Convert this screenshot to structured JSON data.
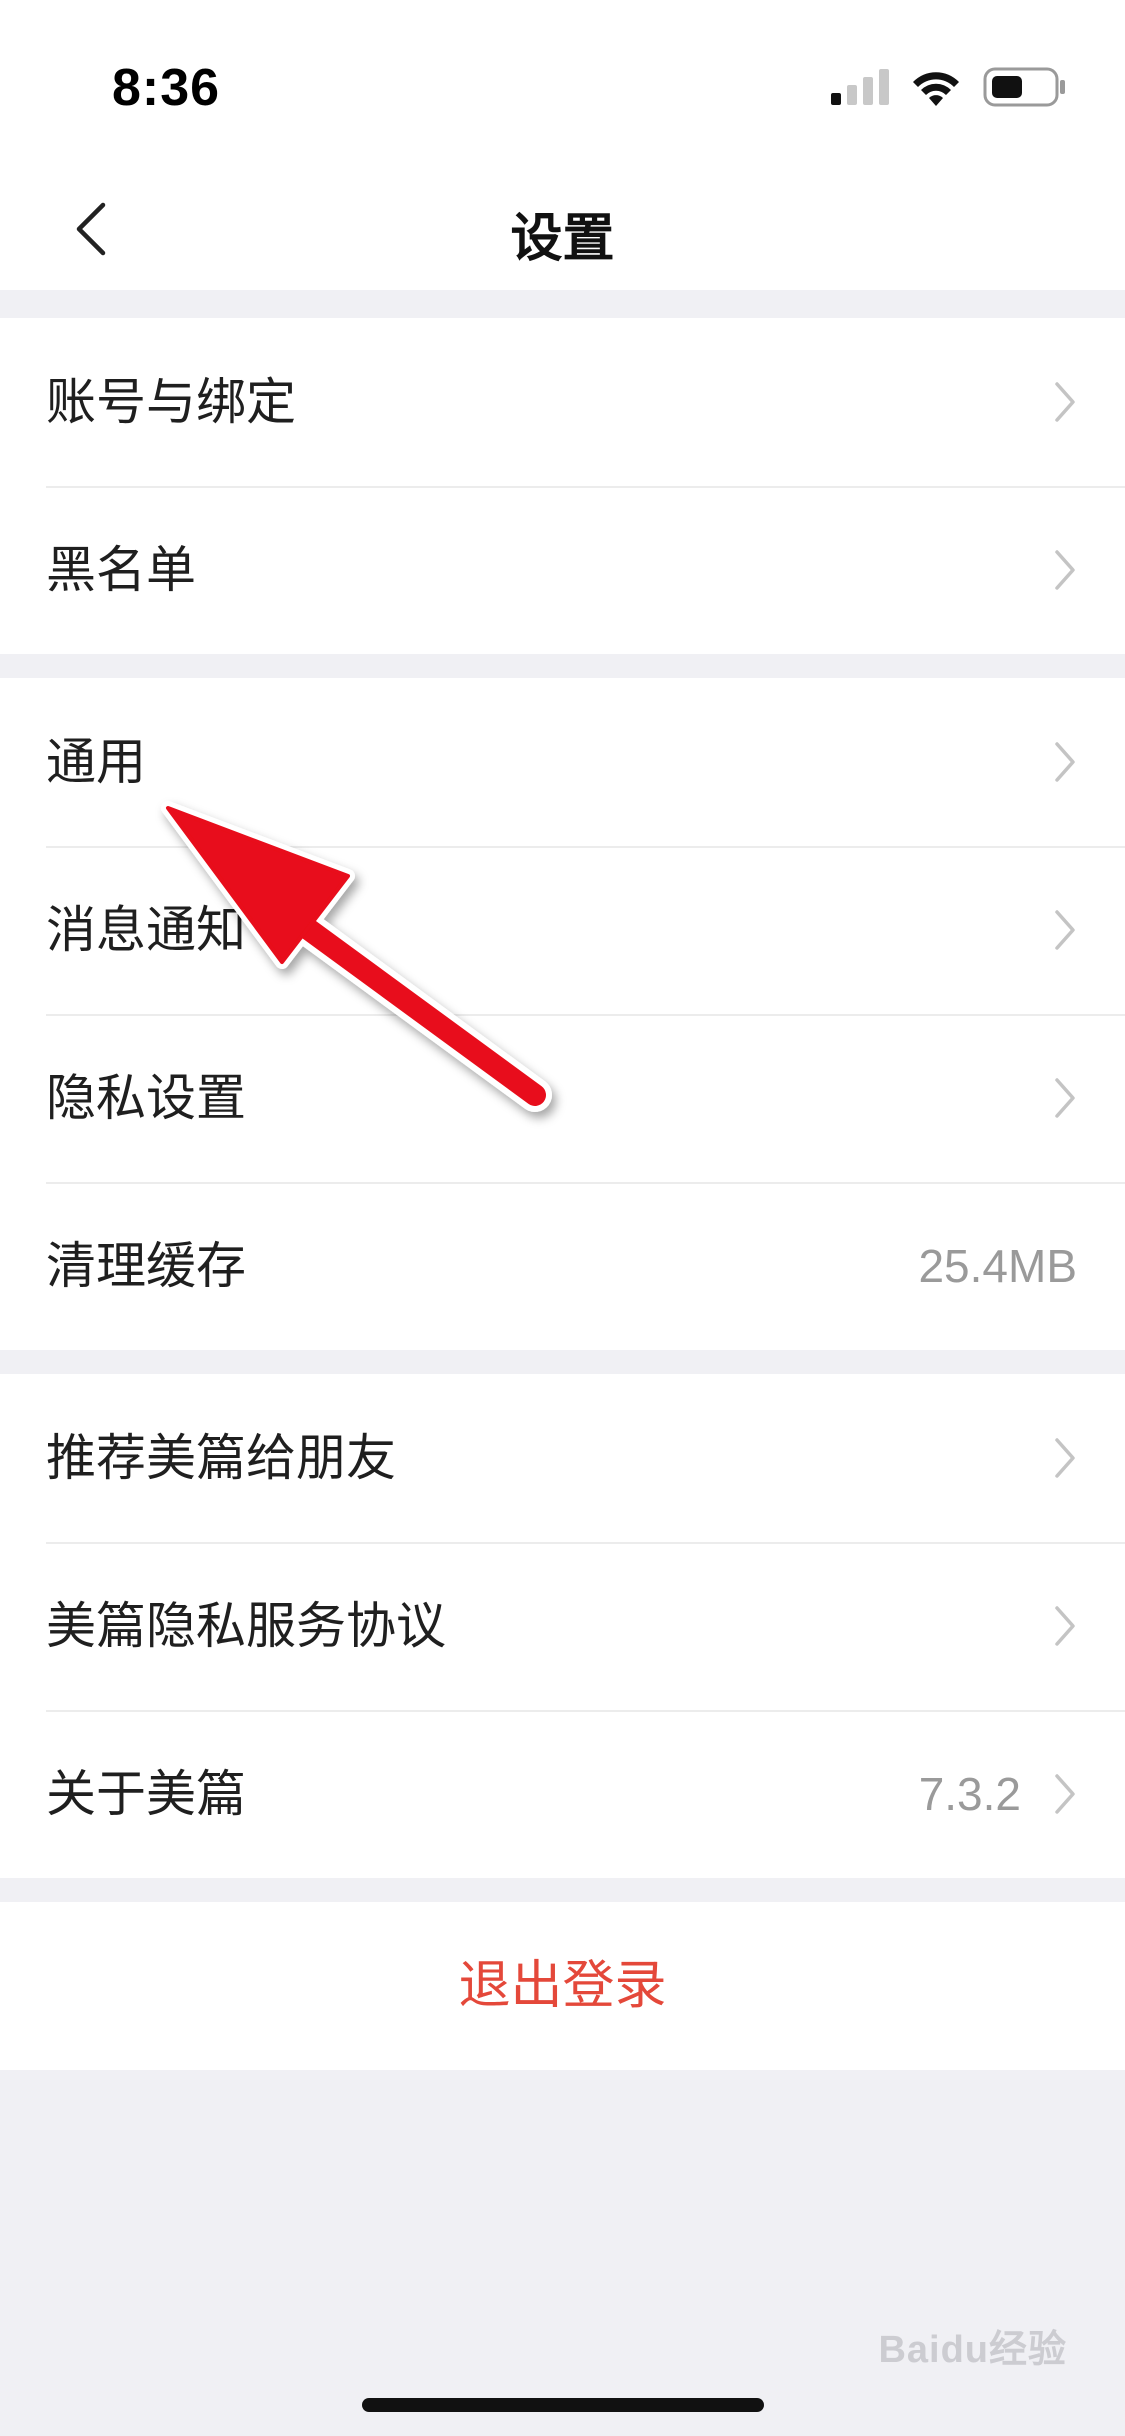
{
  "status_bar": {
    "time": "8:36"
  },
  "nav": {
    "title": "设置"
  },
  "groups": [
    {
      "rows": [
        {
          "label": "账号与绑定"
        },
        {
          "label": "黑名单"
        }
      ]
    },
    {
      "rows": [
        {
          "label": "通用"
        },
        {
          "label": "消息通知"
        },
        {
          "label": "隐私设置"
        },
        {
          "label": "清理缓存",
          "value": "25.4MB"
        }
      ]
    },
    {
      "rows": [
        {
          "label": "推荐美篇给朋友"
        },
        {
          "label": "美篇隐私服务协议"
        },
        {
          "label": "关于美篇",
          "value": "7.3.2"
        }
      ]
    }
  ],
  "logout": {
    "label": "退出登录"
  },
  "watermark": {
    "text": "Baidu经验"
  },
  "colors": {
    "background": "#f0f0f4",
    "logout_text": "#e4483a",
    "annotation_arrow": "#e8101a",
    "secondary_text": "#9a9a9a"
  },
  "icons": {
    "back": "chevron-left-icon",
    "row_disclosure": "chevron-right-icon",
    "signal": "cellular-signal-icon",
    "wifi": "wifi-icon",
    "battery": "battery-icon"
  }
}
